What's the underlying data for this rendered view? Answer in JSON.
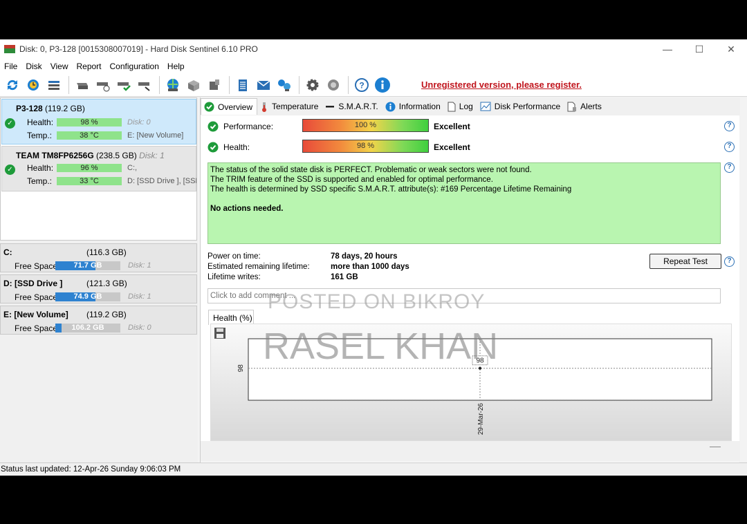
{
  "window": {
    "title": "Disk: 0, P3-128 [0015308007019]  -  Hard Disk Sentinel 6.10 PRO",
    "minimize": "—",
    "maximize": "☐",
    "close": "✕"
  },
  "menu": {
    "file": "File",
    "disk": "Disk",
    "view": "View",
    "report": "Report",
    "configuration": "Configuration",
    "help": "Help"
  },
  "toolbar": {
    "register_text": "Unregistered version, please register."
  },
  "disks": [
    {
      "name": "P3-128",
      "size": "(119.2 GB)",
      "health_label": "Health:",
      "health": "98 %",
      "temp_label": "Temp.:",
      "temp": "38 °C",
      "disk_no": "Disk: 0",
      "volume": "E: [New Volume]"
    },
    {
      "name": "TEAM TM8FP6256G",
      "size": "(238.5 GB)",
      "disk_no": "Disk: 1",
      "health_label": "Health:",
      "health": "96 %",
      "temp_label": "Temp.:",
      "temp": "33 °C",
      "volume_c": "C:,",
      "volume_d": "D: [SSD Drive ],  [SSD"
    }
  ],
  "volumes": [
    {
      "name": "C:",
      "size": "(116.3 GB)",
      "free_label": "Free Space",
      "free": "71.7 GB",
      "free_fraction": 0.62,
      "disk": "Disk: 1"
    },
    {
      "name": "D: [SSD Drive ]",
      "size": "(121.3 GB)",
      "free_label": "Free Space",
      "free": "74.9 GB",
      "free_fraction": 0.62,
      "disk": "Disk: 1"
    },
    {
      "name": "E: [New Volume]",
      "size": "(119.2 GB)",
      "free_label": "Free Space",
      "free": "106.2 GB",
      "free_fraction": 0.1,
      "disk": "Disk: 0"
    }
  ],
  "tabs": {
    "overview": "Overview",
    "temperature": "Temperature",
    "smart": "S.M.A.R.T.",
    "information": "Information",
    "log": "Log",
    "disk_performance": "Disk Performance",
    "alerts": "Alerts"
  },
  "overview": {
    "performance_label": "Performance:",
    "performance_value": "100 %",
    "performance_verdict": "Excellent",
    "health_label": "Health:",
    "health_value": "98 %",
    "health_verdict": "Excellent",
    "status_line1": "The status of the solid state disk is PERFECT. Problematic or weak sectors were not found.",
    "status_line2": "The TRIM feature of the SSD is supported and enabled for optimal performance.",
    "status_line3": "The health is determined by SSD specific S.M.A.R.T. attribute(s):  #169 Percentage Lifetime Remaining",
    "status_action": "No actions needed.",
    "power_on_label": "Power on time:",
    "power_on_value": "78 days, 20 hours",
    "remaining_label": "Estimated remaining lifetime:",
    "remaining_value": "more than 1000 days",
    "writes_label": "Lifetime writes:",
    "writes_value": "161 GB",
    "repeat_test": "Repeat Test",
    "comment_placeholder": "Click to add comment ..."
  },
  "chart_tab": "Health (%)",
  "chart_data": {
    "type": "line",
    "x": [
      "29-Mar-26"
    ],
    "values": [
      98
    ],
    "data_labels": [
      "98"
    ],
    "ylabel_tick": "98",
    "grid": true
  },
  "statusbar": {
    "text": "Status last updated: 12-Apr-26 Sunday 9:06:03 PM"
  },
  "watermark": {
    "line1": "POSTED ON BIKROY",
    "line2": "RASEL KHAN"
  }
}
